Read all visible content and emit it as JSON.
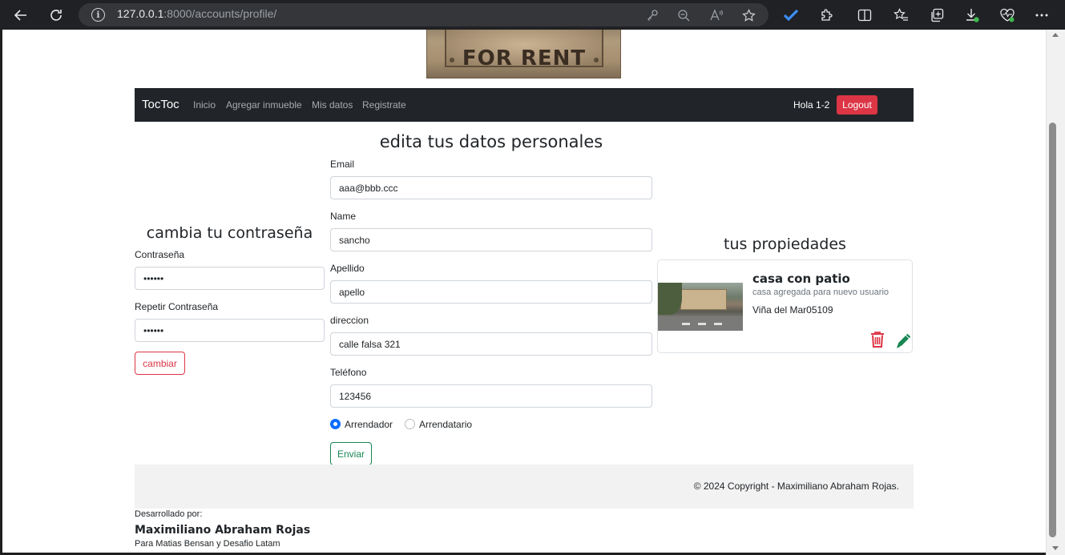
{
  "browser": {
    "url_host": "127.0.0.1",
    "url_rest": ":8000/accounts/profile/"
  },
  "banner": {
    "sign_text": "FOR RENT"
  },
  "navbar": {
    "brand": "TocToc",
    "links": [
      "Inicio",
      "Agregar inmueble",
      "Mis datos",
      "Registrate"
    ],
    "greeting": "Hola 1-2",
    "logout": "Logout"
  },
  "profile_form": {
    "heading": "edita tus datos personales",
    "email_label": "Email",
    "email_value": "aaa@bbb.ccc",
    "name_label": "Name",
    "name_value": "sancho",
    "apellido_label": "Apellido",
    "apellido_value": "apello",
    "direccion_label": "direccion",
    "direccion_value": "calle falsa 321",
    "telefono_label": "Teléfono",
    "telefono_value": "123456",
    "radio_arrendador": "Arrendador",
    "radio_arrendatario": "Arrendatario",
    "selected_role": "Arrendador",
    "submit": "Enviar"
  },
  "password_form": {
    "heading": "cambia tu contraseña",
    "password_label": "Contraseña",
    "password_value": "••••••",
    "repeat_label": "Repetir Contraseña",
    "repeat_value": "••••••",
    "submit": "cambiar"
  },
  "properties": {
    "heading": "tus propiedades",
    "items": [
      {
        "title": "casa con patio",
        "description": "casa agregada para nuevo usuario",
        "location": "Viña del Mar05109"
      }
    ]
  },
  "footer": {
    "copyright": "© 2024 Copyright - Maximiliano Abraham Rojas.",
    "developed_by": "Desarrollado por:",
    "developer": "Maximiliano Abraham Rojas",
    "for": "Para Matias Bensan y Desafio Latam"
  },
  "colors": {
    "navbar_bg": "#212529",
    "logout_bg": "#dc3545",
    "success": "#198754",
    "danger": "#dc3545",
    "radio_checked": "#0d6efd"
  }
}
